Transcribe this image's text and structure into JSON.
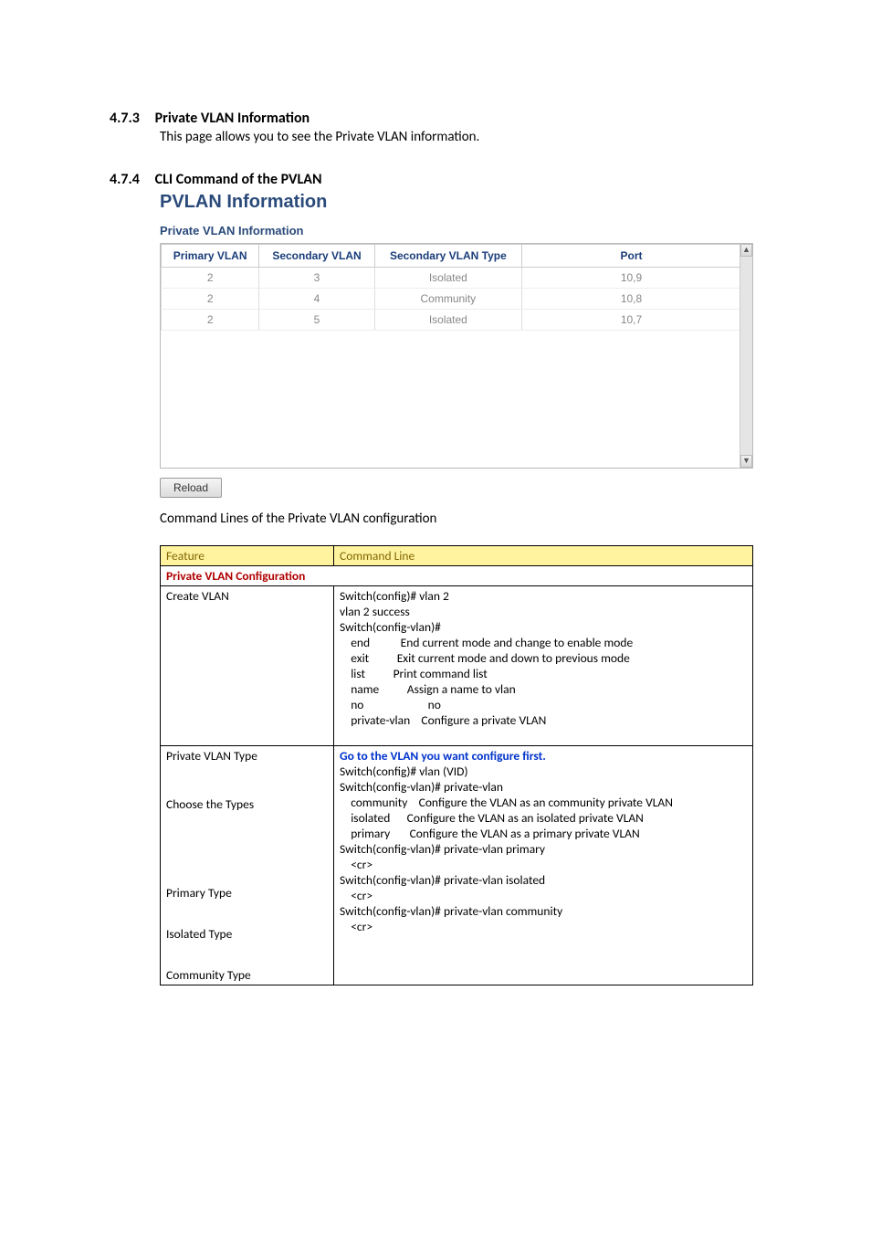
{
  "section1": {
    "num": "4.7.3",
    "title": "Private VLAN Information",
    "body": "This page allows you to see the Private VLAN information."
  },
  "section2": {
    "num": "4.7.4",
    "title": "CLI Command of the PVLAN"
  },
  "panel": {
    "title": "PVLAN Information",
    "subtitle": "Private VLAN Information",
    "headers": {
      "col1": "Primary VLAN",
      "col2": "Secondary VLAN",
      "col3": "Secondary VLAN Type",
      "col4": "Port"
    },
    "rows": [
      {
        "c1": "2",
        "c2": "3",
        "c3": "Isolated",
        "c4": "10,9"
      },
      {
        "c1": "2",
        "c2": "4",
        "c3": "Community",
        "c4": "10,8"
      },
      {
        "c1": "2",
        "c2": "5",
        "c3": "Isolated",
        "c4": "10,7"
      }
    ],
    "reload": "Reload"
  },
  "plain": "Command Lines of the Private VLAN configuration",
  "cmd": {
    "h1": "Feature",
    "h2": "Command Line",
    "section": "Private VLAN Configuration",
    "row1": {
      "f": "Create VLAN",
      "c": "Switch(config)# vlan 2\nvlan 2 success\nSwitch(config-vlan)#\n    end           End current mode and change to enable mode\n    exit          Exit current mode and down to previous mode\n    list          Print command list\n    name          Assign a name to vlan\n    no                       no\n    private-vlan    Configure a private VLAN\n\n"
    },
    "row2": {
      "f1": "Private VLAN Type",
      "f2": "Choose the Types",
      "f3": "Primary Type",
      "f4": "Isolated Type",
      "f5": "Community Type",
      "blue": "Go to the VLAN you want configure first.",
      "c1": "Switch(config)# vlan (VID)\n",
      "c2": "Switch(config-vlan)# private-vlan\n    community    Configure the VLAN as an community private VLAN\n    isolated      Configure the VLAN as an isolated private VLAN\n    primary       Configure the VLAN as a primary private VLAN\n",
      "c3": "Switch(config-vlan)# private-vlan primary\n    <cr>\n",
      "c4": "Switch(config-vlan)# private-vlan isolated\n    <cr>\n",
      "c5": "Switch(config-vlan)# private-vlan community\n    <cr>"
    }
  }
}
